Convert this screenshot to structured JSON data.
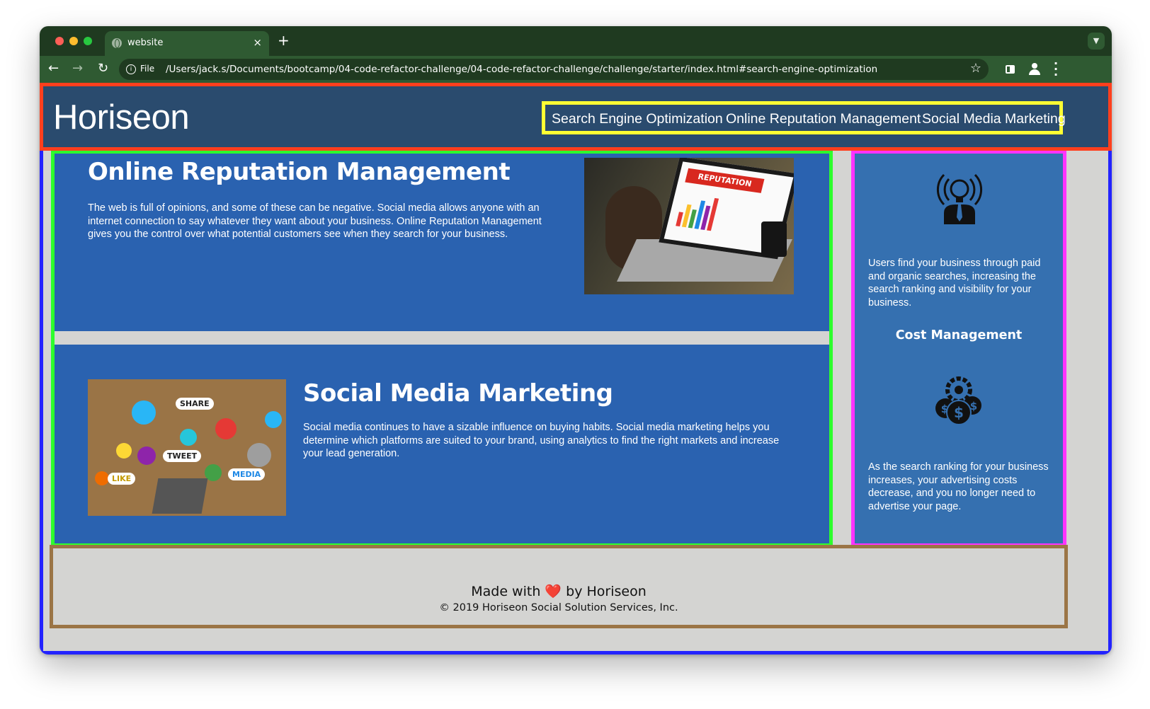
{
  "browser": {
    "tab_title": "website",
    "tab_close": "×",
    "new_tab": "+",
    "address_prefix": "File",
    "url": "/Users/jack.s/Documents/bootcamp/04-code-refactor-challenge/04-code-refactor-challenge/challenge/starter/index.html#search-engine-optimization",
    "icons": [
      "back-icon",
      "forward-icon",
      "reload-icon",
      "info-icon",
      "star-icon",
      "side-panel-icon",
      "profile-icon",
      "kebab-menu-icon",
      "tab-list-icon"
    ]
  },
  "header": {
    "logo": "Horiseon",
    "nav": [
      {
        "label": "Search Engine Optimization"
      },
      {
        "label": "Online Reputation Management"
      },
      {
        "label": "Social Media Marketing"
      }
    ]
  },
  "sections": [
    {
      "heading": "Online Reputation Management",
      "text": "The web is full of opinions, and some of these can be negative. Social media allows anyone with an internet connection to say whatever they want about your business. Online Reputation Management gives you the control over what potential customers see when they search for your business.",
      "image_label": "REPUTATION"
    },
    {
      "heading": "Social Media Marketing",
      "text": "Social media continues to have a sizable influence on buying habits. Social media marketing helps you determine which platforms are suited to your brand, using analytics to find the right markets and increase your lead generation.",
      "image_words": [
        "SHARE",
        "TWEET",
        "LIKE",
        "MEDIA"
      ]
    }
  ],
  "aside": {
    "p1": "Users find your business through paid and organic searches, increasing the search ranking and visibility for your business.",
    "heading": "Cost Management",
    "p2": "As the search ranking for your business increases, your advertising costs decrease, and you no longer need to advertise your page."
  },
  "footer": {
    "made_prefix": "Made with",
    "heart": "❤️",
    "made_suffix": "by Horiseon",
    "copyright": "© 2019 Horiseon Social Solution Services, Inc."
  },
  "colors": {
    "header_bg": "#2a4b6e",
    "content_bg": "#2a62b0",
    "aside_bg": "#3570b0",
    "page_bg": "#d4d4d2",
    "outline_header": "#ff3f1d",
    "outline_nav": "#ffff33",
    "outline_content": "#2dff2d",
    "outline_aside": "#ff33ff",
    "outline_body": "#2323ff",
    "outline_footer": "#9b7546"
  }
}
